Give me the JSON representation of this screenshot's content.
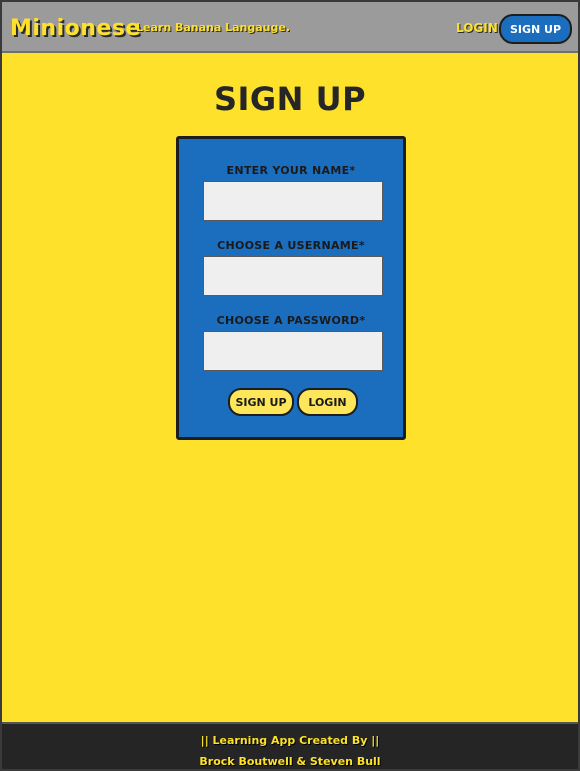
{
  "header": {
    "brand": "Minionese",
    "tagline": "Learn Banana Langauge.",
    "login_link": "Login",
    "signup_button": "Sign Up"
  },
  "main": {
    "title": "Sign Up"
  },
  "form": {
    "name_label": "Enter your name*",
    "name_value": "",
    "username_label": "Choose a username*",
    "username_value": "",
    "password_label": "Choose a password*",
    "password_value": "",
    "signup_button": "Sign Up",
    "login_button": "Login"
  },
  "footer": {
    "line1": "|| Learning App Created By ||",
    "line2": "Brock Boutwell & Steven Bull"
  },
  "colors": {
    "page_background": "#fde12b",
    "header_background": "#9b9b9b",
    "form_background": "#1b6dbd",
    "footer_background": "#252525",
    "button_yellow": "#fde659"
  }
}
